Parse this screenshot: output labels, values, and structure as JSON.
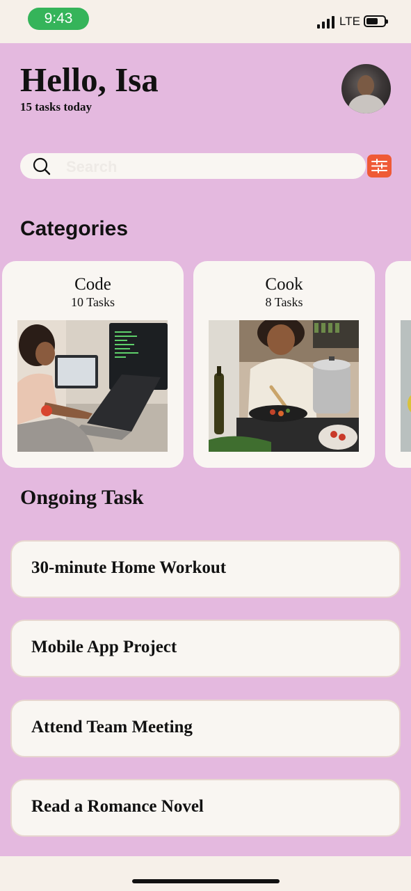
{
  "status_bar": {
    "time": "9:43",
    "network": "LTE"
  },
  "header": {
    "greeting": "Hello, Isa",
    "subtitle": "15 tasks today"
  },
  "search": {
    "placeholder": "Search"
  },
  "categories": {
    "title": "Categories",
    "items": [
      {
        "name": "Code",
        "count": "10 Tasks"
      },
      {
        "name": "Cook",
        "count": "8 Tasks"
      }
    ]
  },
  "ongoing": {
    "title": "Ongoing Task",
    "tasks": [
      {
        "label": "30-minute Home Workout"
      },
      {
        "label": "Mobile App Project"
      },
      {
        "label": "Attend Team Meeting"
      },
      {
        "label": "Read a Romance Novel"
      }
    ]
  },
  "icons": {
    "search": "search-icon",
    "filter": "sliders-icon",
    "signal": "signal-icon",
    "battery": "battery-icon"
  },
  "colors": {
    "background": "#e4b9df",
    "card": "#f9f6f2",
    "accent": "#ef5a36",
    "time_pill": "#35b45a"
  }
}
